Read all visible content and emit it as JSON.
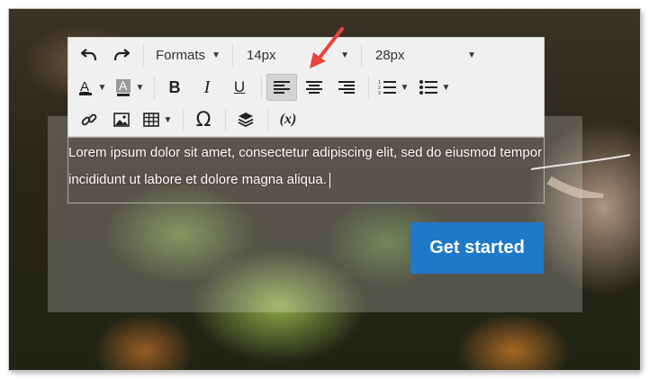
{
  "toolbar": {
    "formats_label": "Formats",
    "font_size_value": "14px",
    "line_height_value": "28px"
  },
  "editor": {
    "text": "Lorem ipsum dolor sit amet, consectetur adipiscing elit, sed do eiusmod tempor incididunt ut labore et dolore magna aliqua."
  },
  "cta": {
    "label": "Get started"
  },
  "annotation": {
    "arrow_color": "#e8453c"
  },
  "colors": {
    "button_blue": "#1f78c8",
    "toolbar_bg": "#f0f0f0"
  }
}
